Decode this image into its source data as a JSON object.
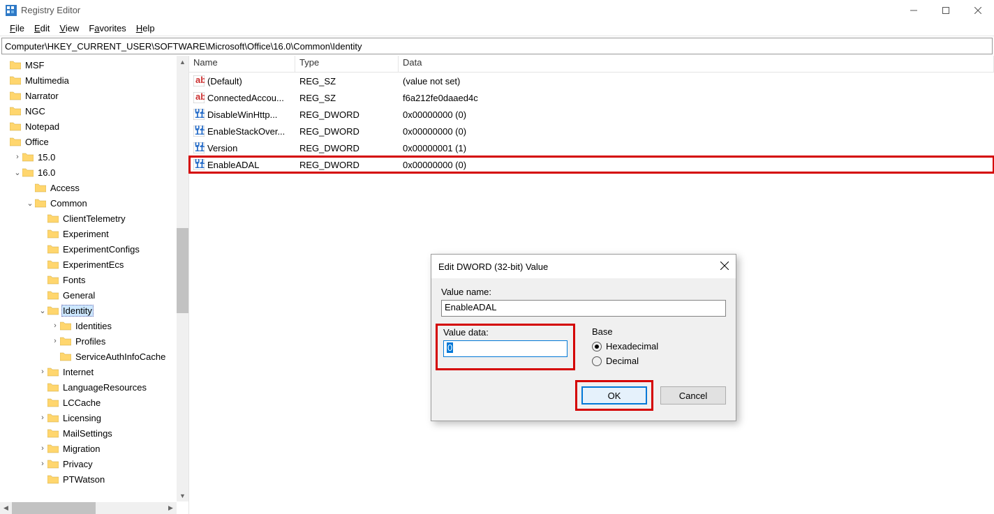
{
  "window": {
    "title": "Registry Editor"
  },
  "menu": {
    "file": "File",
    "edit": "Edit",
    "view": "View",
    "favorites": "Favorites",
    "help": "Help"
  },
  "address": "Computer\\HKEY_CURRENT_USER\\SOFTWARE\\Microsoft\\Office\\16.0\\Common\\Identity",
  "tree": [
    {
      "indent": 0,
      "exp": "",
      "label": "MSF"
    },
    {
      "indent": 0,
      "exp": "",
      "label": "Multimedia"
    },
    {
      "indent": 0,
      "exp": "",
      "label": "Narrator"
    },
    {
      "indent": 0,
      "exp": "",
      "label": "NGC"
    },
    {
      "indent": 0,
      "exp": "",
      "label": "Notepad"
    },
    {
      "indent": 0,
      "exp": "",
      "label": "Office"
    },
    {
      "indent": 1,
      "exp": ">",
      "label": "15.0"
    },
    {
      "indent": 1,
      "exp": "v",
      "label": "16.0"
    },
    {
      "indent": 2,
      "exp": "",
      "label": "Access"
    },
    {
      "indent": 2,
      "exp": "v",
      "label": "Common"
    },
    {
      "indent": 3,
      "exp": "",
      "label": "ClientTelemetry"
    },
    {
      "indent": 3,
      "exp": "",
      "label": "Experiment"
    },
    {
      "indent": 3,
      "exp": "",
      "label": "ExperimentConfigs"
    },
    {
      "indent": 3,
      "exp": "",
      "label": "ExperimentEcs"
    },
    {
      "indent": 3,
      "exp": "",
      "label": "Fonts"
    },
    {
      "indent": 3,
      "exp": "",
      "label": "General"
    },
    {
      "indent": 3,
      "exp": "v",
      "label": "Identity",
      "selected": true
    },
    {
      "indent": 4,
      "exp": ">",
      "label": "Identities"
    },
    {
      "indent": 4,
      "exp": ">",
      "label": "Profiles"
    },
    {
      "indent": 4,
      "exp": "",
      "label": "ServiceAuthInfoCache"
    },
    {
      "indent": 3,
      "exp": ">",
      "label": "Internet"
    },
    {
      "indent": 3,
      "exp": "",
      "label": "LanguageResources"
    },
    {
      "indent": 3,
      "exp": "",
      "label": "LCCache"
    },
    {
      "indent": 3,
      "exp": ">",
      "label": "Licensing"
    },
    {
      "indent": 3,
      "exp": "",
      "label": "MailSettings"
    },
    {
      "indent": 3,
      "exp": ">",
      "label": "Migration"
    },
    {
      "indent": 3,
      "exp": ">",
      "label": "Privacy"
    },
    {
      "indent": 3,
      "exp": "",
      "label": "PTWatson"
    }
  ],
  "list": {
    "cols": {
      "name": "Name",
      "type": "Type",
      "data": "Data"
    },
    "rows": [
      {
        "icon": "sz",
        "name": "(Default)",
        "type": "REG_SZ",
        "data": "(value not set)"
      },
      {
        "icon": "sz",
        "name": "ConnectedAccou...",
        "type": "REG_SZ",
        "data": "f6a212fe0daaed4c"
      },
      {
        "icon": "dw",
        "name": "DisableWinHttp...",
        "type": "REG_DWORD",
        "data": "0x00000000 (0)"
      },
      {
        "icon": "dw",
        "name": "EnableStackOver...",
        "type": "REG_DWORD",
        "data": "0x00000000 (0)"
      },
      {
        "icon": "dw",
        "name": "Version",
        "type": "REG_DWORD",
        "data": "0x00000001 (1)"
      },
      {
        "icon": "dw",
        "name": "EnableADAL",
        "type": "REG_DWORD",
        "data": "0x00000000 (0)",
        "highlight": true
      }
    ]
  },
  "dialog": {
    "title": "Edit DWORD (32-bit) Value",
    "valuename_label": "Value name:",
    "valuename": "EnableADAL",
    "valuedata_label": "Value data:",
    "valuedata": "0",
    "base_label": "Base",
    "base_hex": "Hexadecimal",
    "base_dec": "Decimal",
    "ok": "OK",
    "cancel": "Cancel"
  }
}
